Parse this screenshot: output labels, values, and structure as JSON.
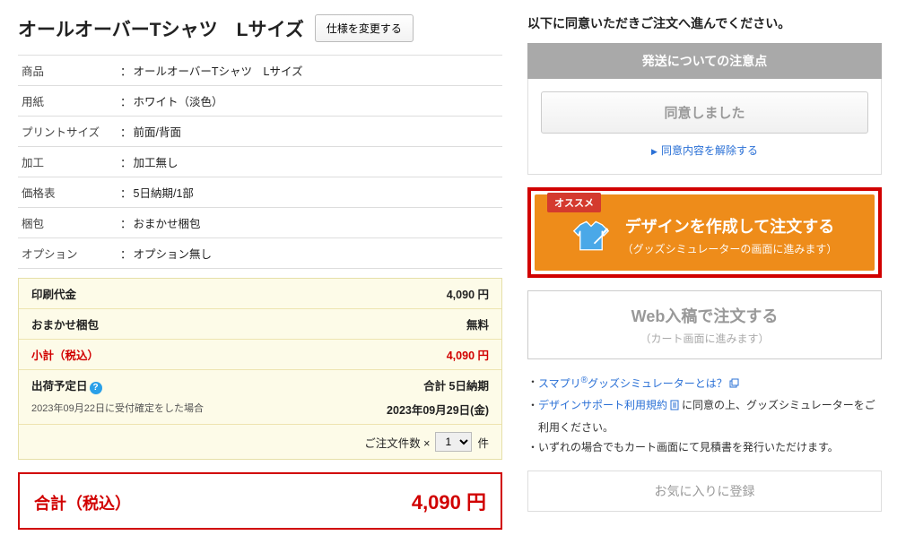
{
  "header": {
    "title": "オールオーバーTシャツ　Lサイズ",
    "change_spec_label": "仕様を変更する"
  },
  "spec": {
    "rows": [
      {
        "k": "商品",
        "v": "オールオーバーTシャツ　Lサイズ"
      },
      {
        "k": "用紙",
        "v": "ホワイト（淡色）"
      },
      {
        "k": "プリントサイズ",
        "v": "前面/背面"
      },
      {
        "k": "加工",
        "v": "加工無し"
      },
      {
        "k": "価格表",
        "v": "5日納期/1部"
      },
      {
        "k": "梱包",
        "v": "おまかせ梱包"
      },
      {
        "k": "オプション",
        "v": "オプション無し"
      }
    ]
  },
  "price": {
    "print_label": "印刷代金",
    "print_value": "4,090 円",
    "pack_label": "おまかせ梱包",
    "pack_value": "無料",
    "subtotal_label": "小計（税込）",
    "subtotal_value": "4,090 円",
    "ship_date_label": "出荷予定日",
    "ship_total_label": "合計 5日納期",
    "ship_note": "2023年09月22日に受付確定をした場合",
    "ship_date_value": "2023年09月29日(金)",
    "qty_label": "ご注文件数 ×",
    "qty_value": "1",
    "qty_unit": "件"
  },
  "total": {
    "label": "合計（税込）",
    "value": "4,090 円"
  },
  "right": {
    "heading": "以下に同意いただきご注文へ進んでください。",
    "ship_head": "発送についての注意点",
    "agreed_label": "同意しました",
    "unlock_label": "同意内容を解除する",
    "recommend_badge": "オススメ",
    "design_title": "デザインを作成して注文する",
    "design_sub": "（グッズシミュレーターの画面に進みます）",
    "web_title": "Web入稿で注文する",
    "web_sub": "（カート画面に進みます）",
    "note1_a": "スマプリ",
    "note1_b": "グッズシミュレーターとは？",
    "note2_a": "デザインサポート利用規約",
    "note2_b": "に同意の上、グッズシミュレーターをご利用ください。",
    "note3": "いずれの場合でもカート画面にて見積書を発行いただけます。",
    "fav_label": "お気に入りに登録"
  }
}
